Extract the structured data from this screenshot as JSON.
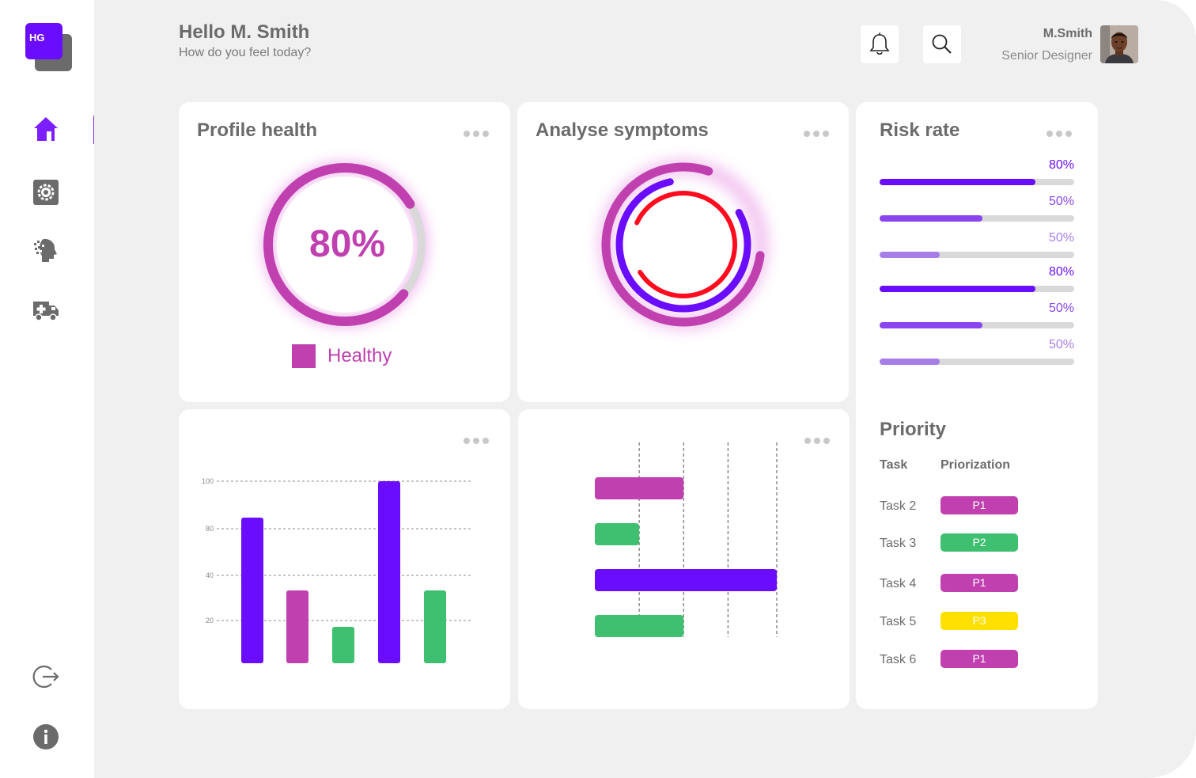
{
  "logo": {
    "text": "HG"
  },
  "sidebar": {
    "items": [
      {
        "icon": "home-icon",
        "active": true
      },
      {
        "icon": "settings-icon"
      },
      {
        "icon": "ai-head-icon"
      },
      {
        "icon": "ambulance-icon"
      }
    ],
    "bottom": [
      {
        "icon": "logout-icon"
      },
      {
        "icon": "info-icon"
      }
    ]
  },
  "header": {
    "greeting": "Hello M. Smith",
    "subtitle": "How do you feel today?",
    "user_name": "M.Smith",
    "user_role": "Senior Designer"
  },
  "profile_health": {
    "title": "Profile health",
    "percent_label": "80%",
    "value": 0.8,
    "legend": "Healthy"
  },
  "analyse_symptoms": {
    "title": "Analyse symptoms",
    "rings": [
      {
        "color": "#c040b0",
        "fraction": 0.78
      },
      {
        "color": "#6a0dff",
        "fraction": 0.8
      },
      {
        "color": "#ff0d1f",
        "fraction": 0.84
      }
    ]
  },
  "risk_rate": {
    "title": "Risk rate",
    "items": [
      {
        "label": "80%",
        "value": 0.8,
        "color": "#6a0dff"
      },
      {
        "label": "50%",
        "value": 0.53,
        "color": "#8a45f0"
      },
      {
        "label": "50%",
        "value": 0.31,
        "color": "#a77de8"
      },
      {
        "label": "80%",
        "value": 0.8,
        "color": "#6a0dff"
      },
      {
        "label": "50%",
        "value": 0.53,
        "color": "#8a45f0"
      },
      {
        "label": "50%",
        "value": 0.31,
        "color": "#a77de8"
      }
    ]
  },
  "priority": {
    "title": "Priority",
    "col_task": "Task",
    "col_prio": "Priorization",
    "rows": [
      {
        "task": "Task 2",
        "badge": "P1",
        "color": "#c040b0"
      },
      {
        "task": "Task 3",
        "badge": "P2",
        "color": "#3fbf70"
      },
      {
        "task": "Task 4",
        "badge": "P1",
        "color": "#c040b0"
      },
      {
        "task": "Task 5",
        "badge": "P3",
        "color": "#ffe000"
      },
      {
        "task": "Task 6",
        "badge": "P1",
        "color": "#c040b0"
      }
    ]
  },
  "colors": {
    "purple": "#6a0dff",
    "magenta": "#c040b0",
    "green": "#3fbf70",
    "red": "#ff0d1f",
    "yellow": "#ffe000"
  },
  "chart_data": [
    {
      "type": "bar",
      "y_ticks": [
        "100",
        "80",
        "40",
        "20"
      ],
      "values": [
        80,
        40,
        20,
        100,
        40
      ],
      "colors": [
        "#6a0dff",
        "#c040b0",
        "#3fbf70",
        "#6a0dff",
        "#3fbf70"
      ]
    },
    {
      "type": "bar",
      "orientation": "horizontal",
      "values": [
        2,
        1,
        4.1,
        2
      ],
      "xlim": [
        0,
        4.1
      ],
      "colors": [
        "#c040b0",
        "#3fbf70",
        "#6a0dff",
        "#3fbf70"
      ]
    }
  ]
}
